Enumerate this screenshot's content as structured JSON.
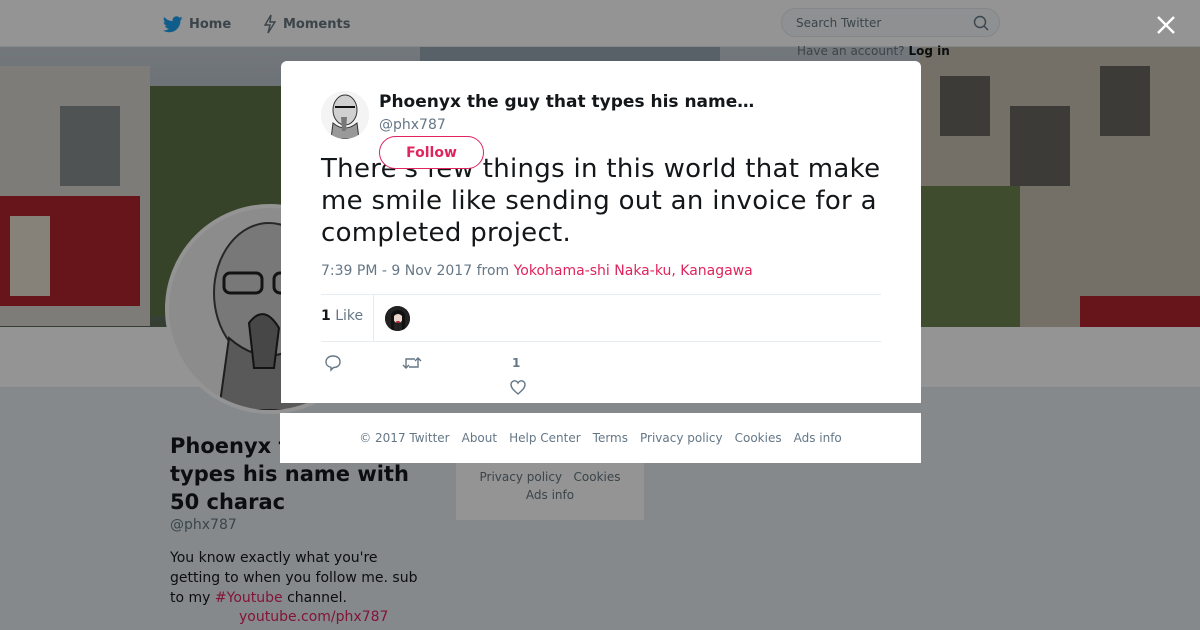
{
  "topnav": {
    "home_label": "Home",
    "moments_label": "Moments",
    "search_placeholder": "Search Twitter",
    "login_text": "Have an account?",
    "login_link": "Log in"
  },
  "profile": {
    "name": "Phoenyx the guy that types his name with 50 charac",
    "handle": "@phx787",
    "bio_text": "You know exactly what you're getting to when you follow me. sub to my ",
    "bio_hashtag": "#Youtube",
    "bio_suffix": " channel.",
    "link": "youtube.com/phx787"
  },
  "side_footer": {
    "row1": [
      "Privacy policy",
      "Cookies"
    ],
    "row2": "Ads info"
  },
  "tweet": {
    "display_name": "Phoenyx the guy that types his name…",
    "handle": "@phx787",
    "follow_label": "Follow",
    "text": "There's few things in this world that make me smile like sending out an invoice for a completed project.",
    "time": "7:39 PM - 9 Nov 2017 from ",
    "location": "Yokohama-shi Naka-ku, Kanagawa",
    "likes_count": "1",
    "likes_label": "Like",
    "like_action_count": "1"
  },
  "modal_footer": [
    "© 2017 Twitter",
    "About",
    "Help Center",
    "Terms",
    "Privacy policy",
    "Cookies",
    "Ads info"
  ],
  "colors": {
    "accent": "#e0245e",
    "twitter_blue": "#1da1f2",
    "text_secondary": "#657786",
    "overlay": "rgba(0,0,0,0.42)"
  }
}
